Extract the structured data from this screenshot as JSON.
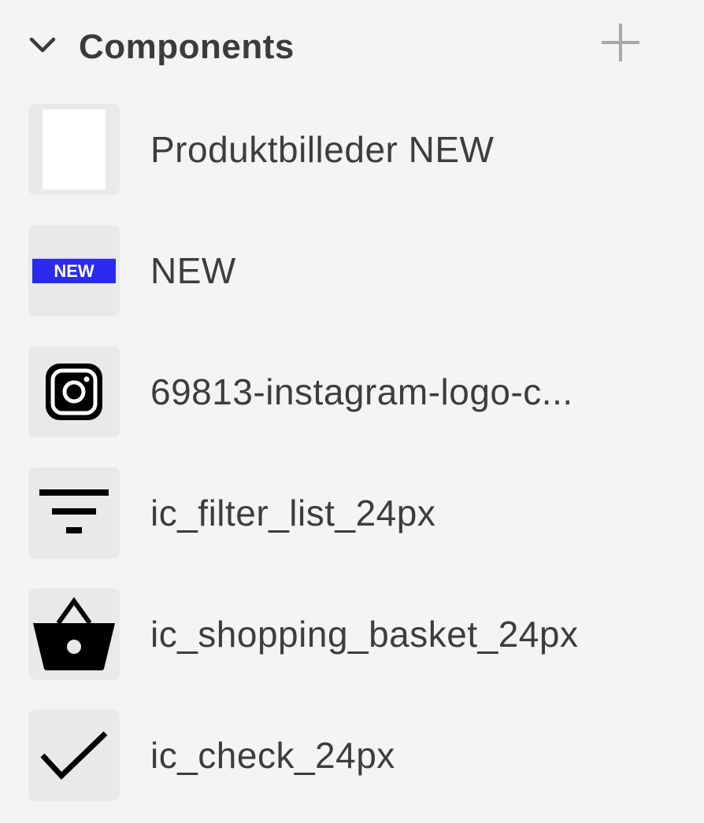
{
  "section": {
    "title": "Components",
    "collapse_icon": "chevron-down-icon",
    "add_icon": "plus-icon"
  },
  "components": [
    {
      "label": "Produktbilleder NEW",
      "icon": "blank-image-icon"
    },
    {
      "label": "NEW",
      "icon": "new-badge-icon",
      "badge_text": "NEW",
      "badge_color": "#2b2bef"
    },
    {
      "label": "69813-instagram-logo-c...",
      "icon": "instagram-icon"
    },
    {
      "label": "ic_filter_list_24px",
      "icon": "filter-list-icon"
    },
    {
      "label": "ic_shopping_basket_24px",
      "icon": "shopping-basket-icon"
    },
    {
      "label": "ic_check_24px",
      "icon": "check-icon"
    }
  ],
  "colors": {
    "background": "#f4f4f4",
    "thumb_background": "#e9e9e9",
    "text": "#3d3d3d",
    "muted_icon": "#a9a9a9"
  }
}
